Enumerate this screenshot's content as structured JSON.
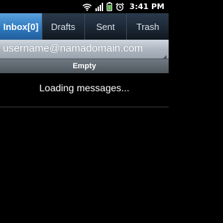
{
  "status_bar": {
    "time": "3:41 PM",
    "icons": [
      "wifi-icon",
      "signal-icon",
      "battery-icon",
      "alarm-icon"
    ]
  },
  "tabs": [
    {
      "label": "Inbox[0]",
      "active": true
    },
    {
      "label": "Drafts",
      "active": false
    },
    {
      "label": "Sent",
      "active": false
    },
    {
      "label": "Trash",
      "active": false
    }
  ],
  "account": {
    "email": "username@namadomain.com"
  },
  "folder_status": "Empty",
  "main": {
    "loading_text": "Loading messages..."
  },
  "colors": {
    "background": "#000000",
    "active_tab": "#3b86c9",
    "inactive_tab": "#1c2835",
    "account_bar": "#b4bcc6",
    "status_strip": "#5c656d"
  }
}
